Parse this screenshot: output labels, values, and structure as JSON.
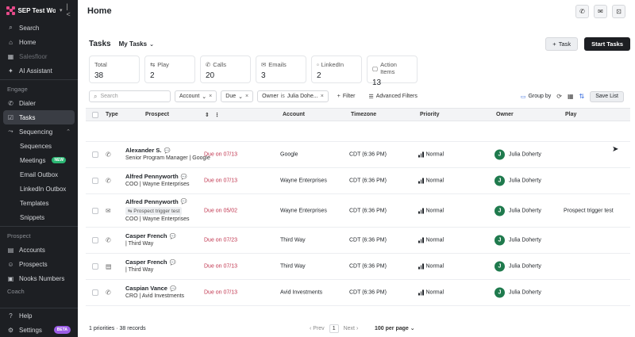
{
  "sidebar": {
    "workspace": "SEP Test Wo...",
    "items": [
      {
        "name": "search",
        "label": "Search",
        "icon": "search-icon"
      },
      {
        "name": "home",
        "label": "Home",
        "icon": "home-icon"
      },
      {
        "name": "salesfloor",
        "label": "Salesfloor",
        "icon": "salesfloor-icon"
      },
      {
        "name": "ai-assistant",
        "label": "AI Assistant",
        "icon": "sparkle-icon"
      }
    ],
    "engage_label": "Engage",
    "engage_items": [
      {
        "name": "dialer",
        "label": "Dialer"
      },
      {
        "name": "tasks",
        "label": "Tasks"
      },
      {
        "name": "sequencing",
        "label": "Sequencing"
      }
    ],
    "sequencing_sub": [
      "Sequences",
      "Meetings",
      "Email Outbox",
      "LinkedIn Outbox",
      "Templates",
      "Snippets"
    ],
    "new_badge": "NEW",
    "prospect_label": "Prospect",
    "prospect_items": [
      "Accounts",
      "Prospects",
      "Nooks Numbers"
    ],
    "coach_label": "Coach",
    "help": "Help",
    "settings": "Settings",
    "beta_badge": "BETA"
  },
  "header": {
    "title": "Home"
  },
  "tasks": {
    "title": "Tasks",
    "view": "My Tasks",
    "add_task": "Task",
    "start_tasks": "Start Tasks"
  },
  "stats": [
    {
      "label": "Total",
      "value": "38",
      "icon": ""
    },
    {
      "label": "Play",
      "value": "2",
      "icon": "play-icon"
    },
    {
      "label": "Calls",
      "value": "20",
      "icon": "phone-icon"
    },
    {
      "label": "Emails",
      "value": "3",
      "icon": "mail-icon"
    },
    {
      "label": "LinkedIn",
      "value": "2",
      "icon": "linkedin-icon"
    },
    {
      "label": "Action Items",
      "value": "13",
      "icon": "action-items-icon"
    }
  ],
  "filters": {
    "search_placeholder": "Search",
    "account": "Account",
    "due": "Due",
    "owner_key": "Owner",
    "owner_op": "is",
    "owner_value": "Julia Dohe...",
    "filter": "Filter",
    "advanced": "Advanced Filters",
    "group_by": "Group by",
    "save_list": "Save List"
  },
  "columns": {
    "type": "Type",
    "prospect": "Prospect",
    "account": "Account",
    "timezone": "Timezone",
    "priority": "Priority",
    "owner": "Owner",
    "play": "Play"
  },
  "rows": [
    {
      "type_icon": "phone-icon",
      "name": "Alexander S.",
      "sub": "Senior Program Manager | Google",
      "trigger": "",
      "due": "Due on 07/13",
      "account": "Google",
      "timezone": "CDT (6:36 PM)",
      "priority": "Normal",
      "owner": "Julia Doherty",
      "owner_initial": "J",
      "play": ""
    },
    {
      "type_icon": "phone-icon",
      "name": "Alfred Pennyworth",
      "sub": "COO | Wayne Enterprises",
      "trigger": "",
      "due": "Due on 07/13",
      "account": "Wayne Enterprises",
      "timezone": "CDT (6:36 PM)",
      "priority": "Normal",
      "owner": "Julia Doherty",
      "owner_initial": "J",
      "play": ""
    },
    {
      "type_icon": "mail-icon",
      "name": "Alfred Pennyworth",
      "sub": "COO | Wayne Enterprises",
      "trigger": "Prospect trigger test",
      "due": "Due on 05/02",
      "account": "Wayne Enterprises",
      "timezone": "CDT (6:36 PM)",
      "priority": "Normal",
      "owner": "Julia Doherty",
      "owner_initial": "J",
      "play": "Prospect trigger test"
    },
    {
      "type_icon": "phone-icon",
      "name": "Casper French",
      "sub": "| Third Way",
      "trigger": "",
      "due": "Due on 07/23",
      "account": "Third Way",
      "timezone": "CDT (6:36 PM)",
      "priority": "Normal",
      "owner": "Julia Doherty",
      "owner_initial": "J",
      "play": ""
    },
    {
      "type_icon": "clipboard-icon",
      "name": "Casper French",
      "sub": "| Third Way",
      "trigger": "",
      "due": "Due on 07/13",
      "account": "Third Way",
      "timezone": "CDT (6:36 PM)",
      "priority": "Normal",
      "owner": "Julia Doherty",
      "owner_initial": "J",
      "play": ""
    },
    {
      "type_icon": "phone-icon",
      "name": "Caspian Vance",
      "sub": "CRO | Avid Investments",
      "trigger": "",
      "due": "Due on 07/13",
      "account": "Avid Investments",
      "timezone": "CDT (6:36 PM)",
      "priority": "Normal",
      "owner": "Julia Doherty",
      "owner_initial": "J",
      "play": ""
    }
  ],
  "footer": {
    "summary": "1 priorities · 38 records",
    "prev": "Prev",
    "page": "1",
    "next": "Next",
    "per_page": "100 per page"
  },
  "colors": {
    "accent": "#3b6fe0",
    "due": "#c0344e",
    "avatar": "#1f7a4d",
    "sidebar": "#1d1f23"
  }
}
